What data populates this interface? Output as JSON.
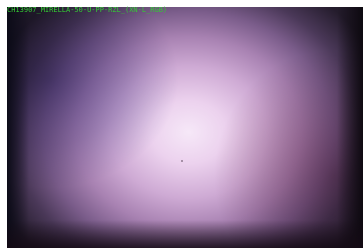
{
  "image": {
    "label": "CH13907_MIRELLA-50-U-PP-RZL_(XN-L_RGB)",
    "label_color": "#33cc33",
    "center_color": "#f4e6f6",
    "edge_color": "#1a1420"
  }
}
